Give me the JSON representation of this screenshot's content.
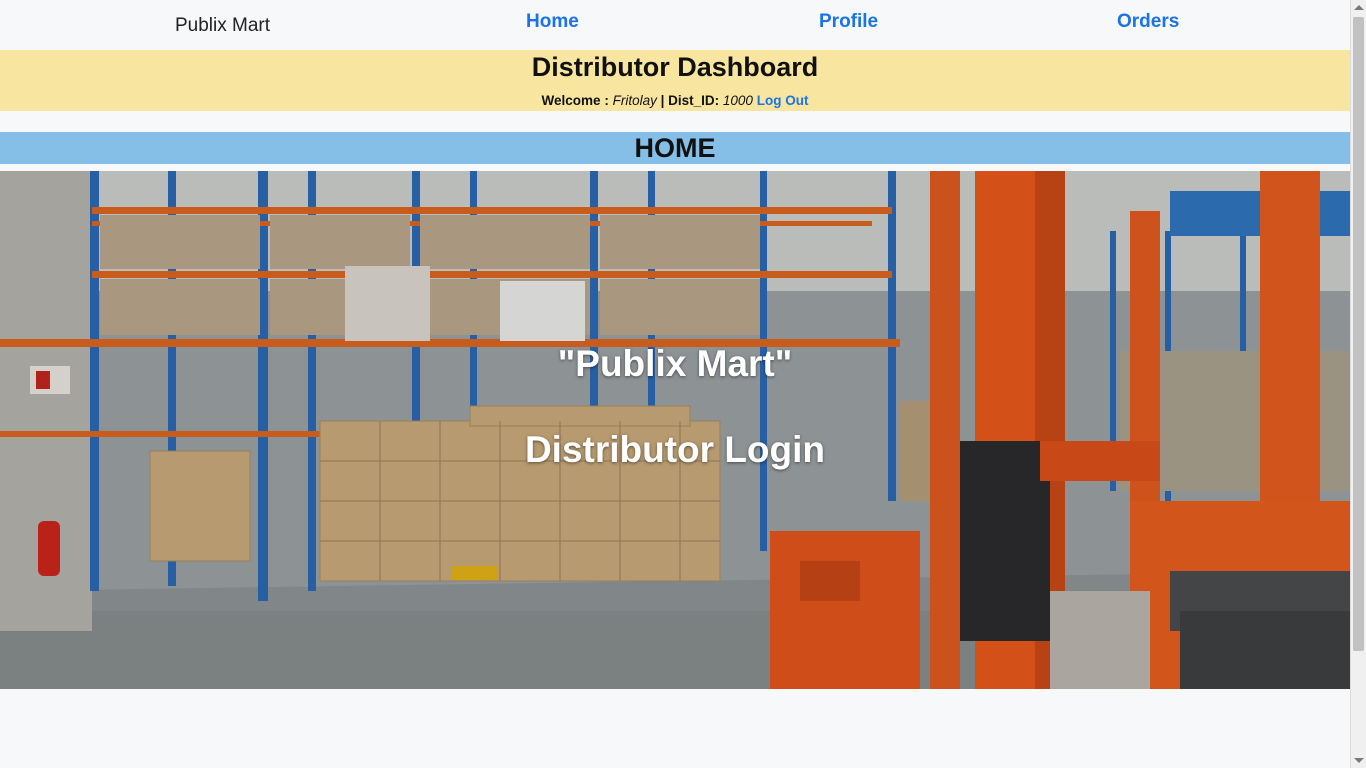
{
  "navbar": {
    "brand": "Publix Mart",
    "links": [
      "Home",
      "Profile",
      "Orders"
    ]
  },
  "dashboard": {
    "title": "Distributor Dashboard",
    "welcome_label": "Welcome : ",
    "user_name": "Fritolay",
    "separator": " | Dist_ID: ",
    "dist_id": "1000",
    "logout_label": "Log Out"
  },
  "home_band": {
    "title": "HOME"
  },
  "hero": {
    "line1": "\"Publix Mart\"",
    "line2": "Distributor Login",
    "image": "warehouse-photo"
  },
  "colors": {
    "link": "#1a73e8",
    "dashboard_bg": "#f8e6a0",
    "home_band_bg": "#85bfe8",
    "page_bg": "#f7f8fa"
  }
}
